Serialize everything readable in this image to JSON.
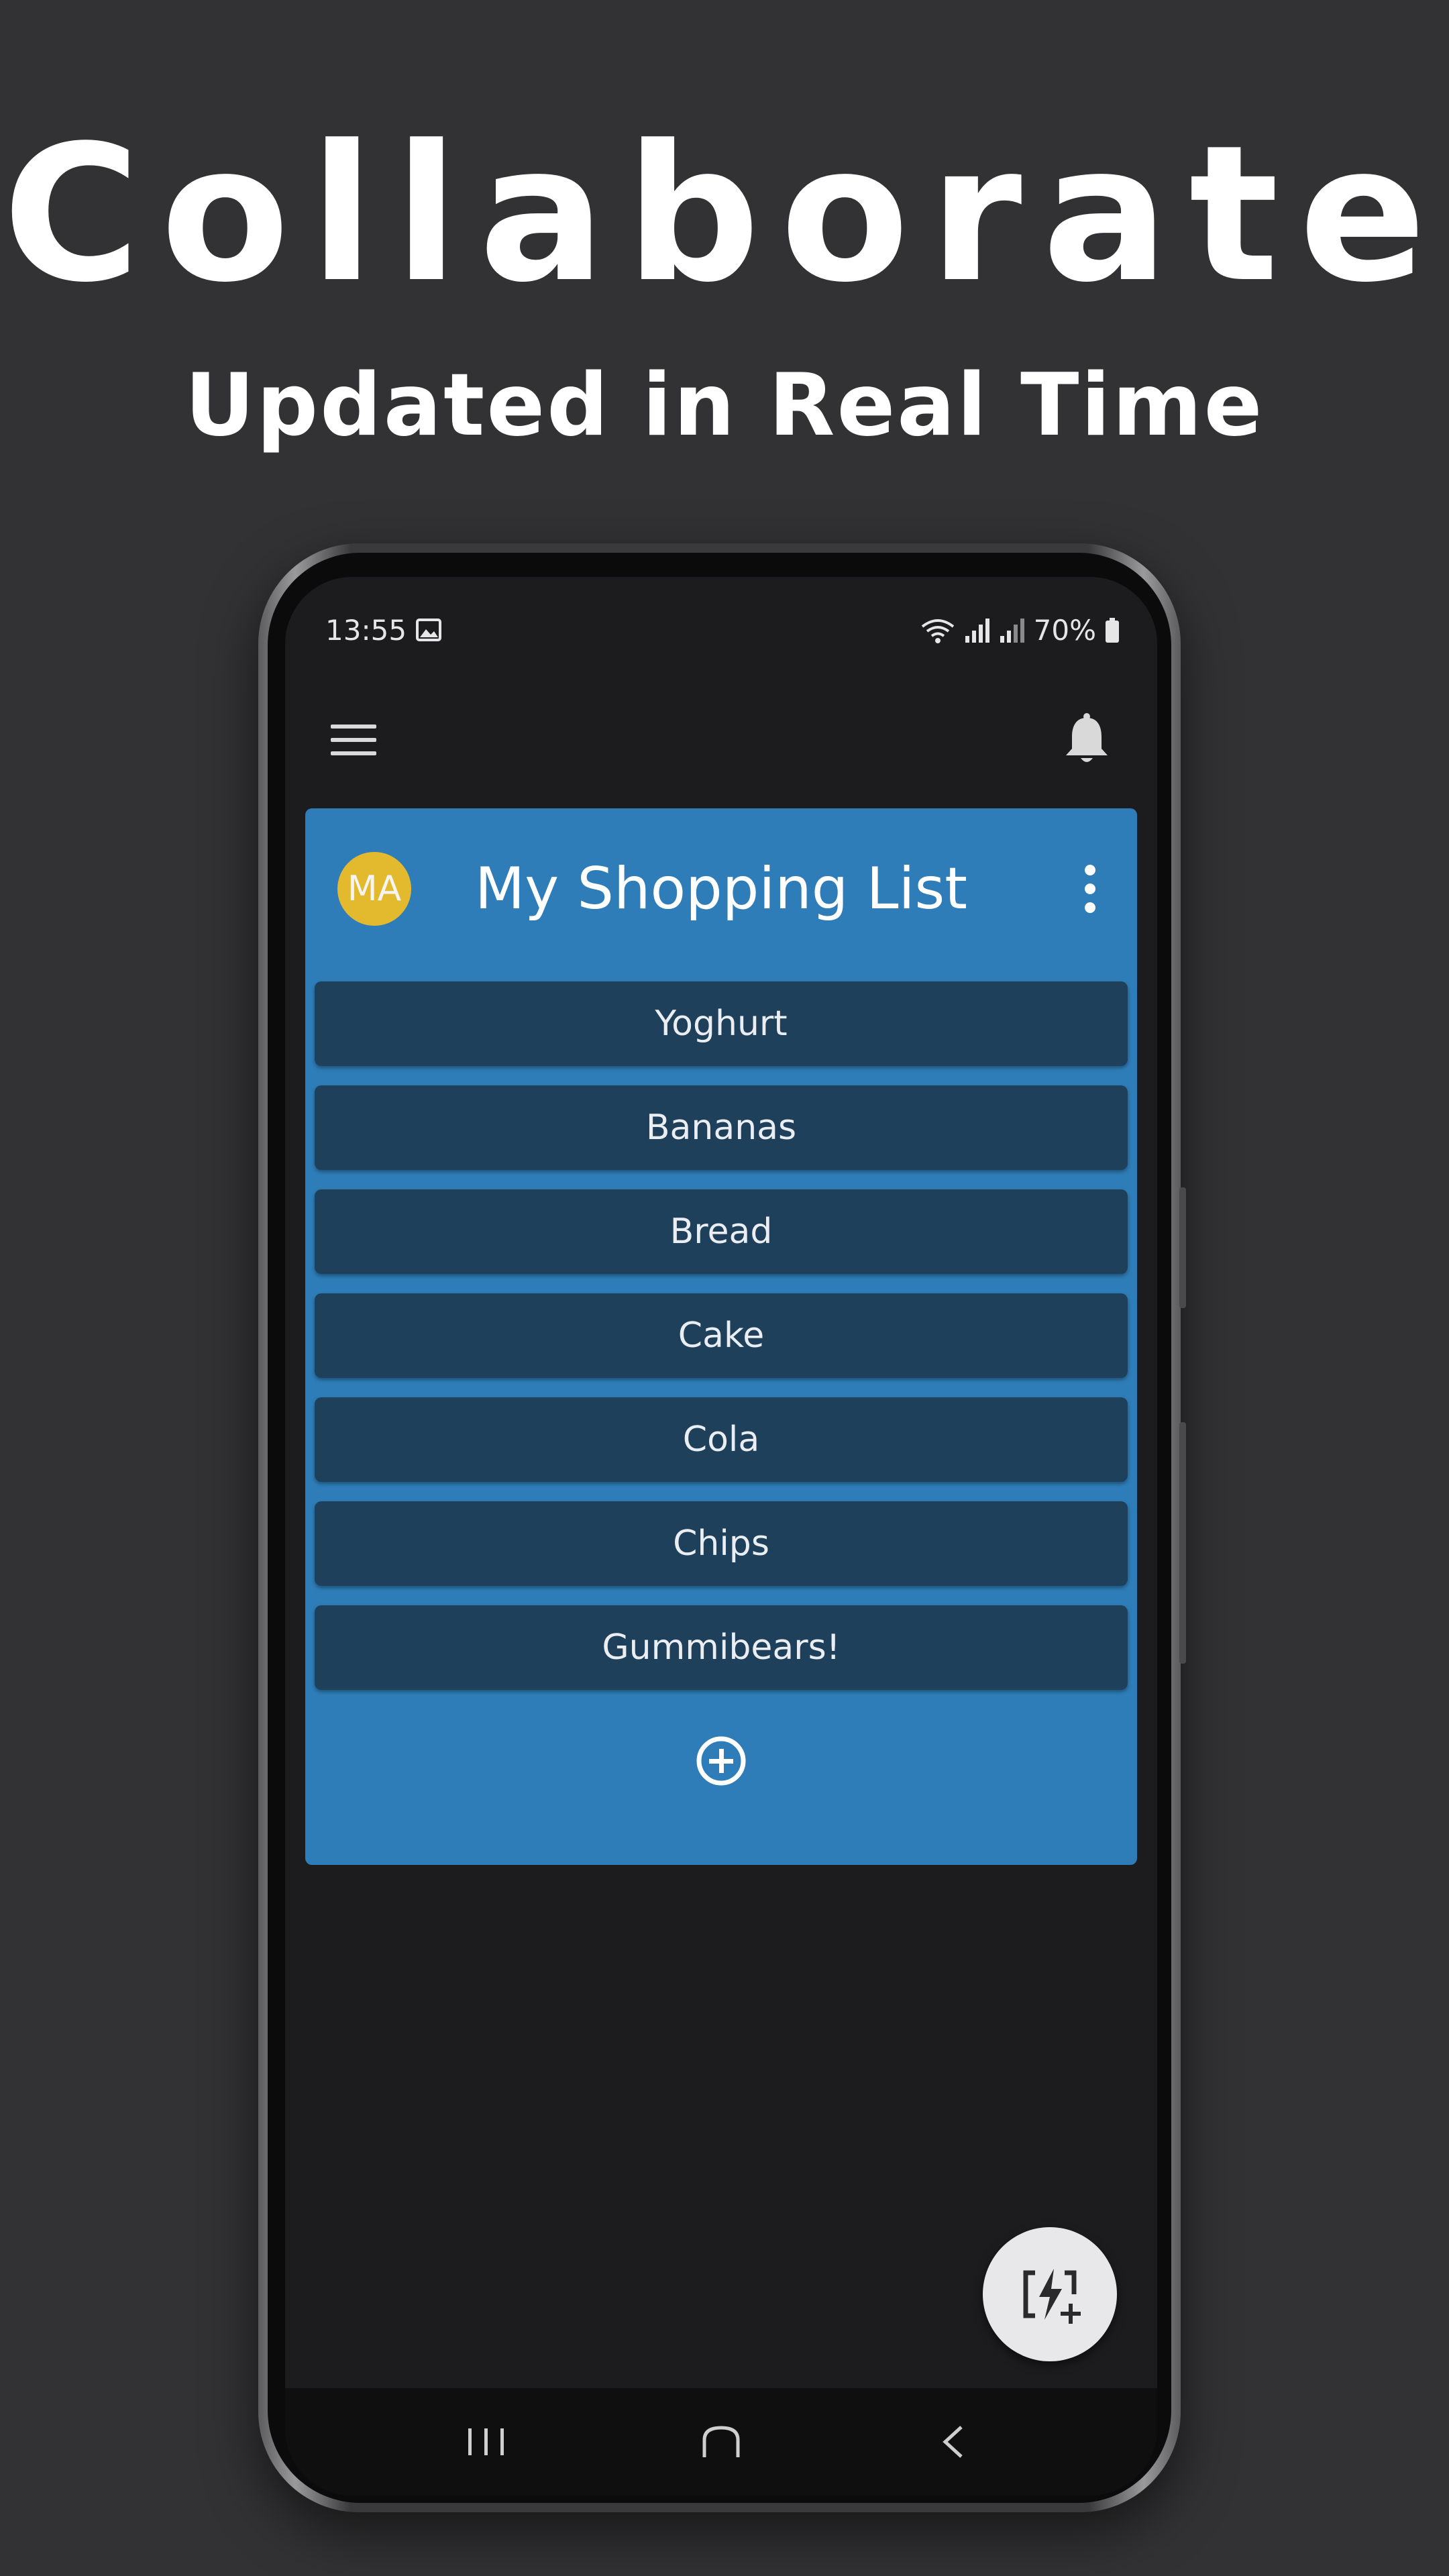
{
  "promo": {
    "headline": "Collaborate",
    "subheadline": "Updated in Real Time"
  },
  "status_bar": {
    "time": "13:55",
    "battery": "70%",
    "icons": [
      "image-icon",
      "wifi-icon",
      "signal-icon",
      "signal-icon",
      "battery-icon"
    ]
  },
  "app_bar": {
    "menu_icon": "menu-icon",
    "notifications_icon": "bell-icon"
  },
  "list": {
    "avatar_initials": "MA",
    "title": "My Shopping List",
    "more_icon": "more-vertical-icon",
    "items": [
      "Yoghurt",
      "Bananas",
      "Bread",
      "Cake",
      "Cola",
      "Chips",
      "Gummibears!"
    ],
    "add_icon": "add-circle-icon"
  },
  "fab": {
    "icon": "quick-add-icon"
  },
  "nav": {
    "icons": [
      "recent-apps-icon",
      "home-icon",
      "back-icon"
    ]
  },
  "colors": {
    "background": "#323234",
    "screen": "#1c1c1e",
    "card": "#2e7db8",
    "item": "#1e405b",
    "avatar": "#e3b92e",
    "fab": "#e8e8ea"
  }
}
